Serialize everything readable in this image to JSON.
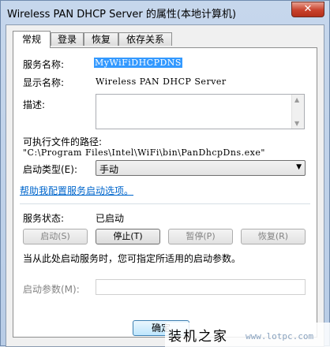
{
  "window": {
    "title": "Wireless PAN DHCP Server 的属性(本地计算机)",
    "close_glyph": "✕"
  },
  "tabs": [
    {
      "label": "常规",
      "active": true
    },
    {
      "label": "登录",
      "active": false
    },
    {
      "label": "恢复",
      "active": false
    },
    {
      "label": "依存关系",
      "active": false
    }
  ],
  "general": {
    "service_name_label": "服务名称:",
    "service_name_value": "MyWiFiDHCPDNS",
    "display_name_label": "显示名称:",
    "display_name_value": "Wireless PAN DHCP Server",
    "description_label": "描述:",
    "exe_path_label": "可执行文件的路径:",
    "exe_path_value": "\"C:\\Program Files\\Intel\\WiFi\\bin\\PanDhcpDns.exe\"",
    "startup_type_label": "启动类型(E):",
    "startup_type_value": "手动",
    "help_link": "帮助我配置服务启动选项。",
    "status_label": "服务状态:",
    "status_value": "已启动",
    "buttons": {
      "start": "启动(S)",
      "stop": "停止(T)",
      "pause": "暂停(P)",
      "resume": "恢复(R)"
    },
    "hint": "当从此处启动服务时，您可指定所适用的启动参数。",
    "start_params_label": "启动参数(M):",
    "start_params_value": ""
  },
  "footer": {
    "ok_label": "确定"
  },
  "watermark": {
    "brand": "装机之家",
    "url": "www.lotpc.com"
  }
}
